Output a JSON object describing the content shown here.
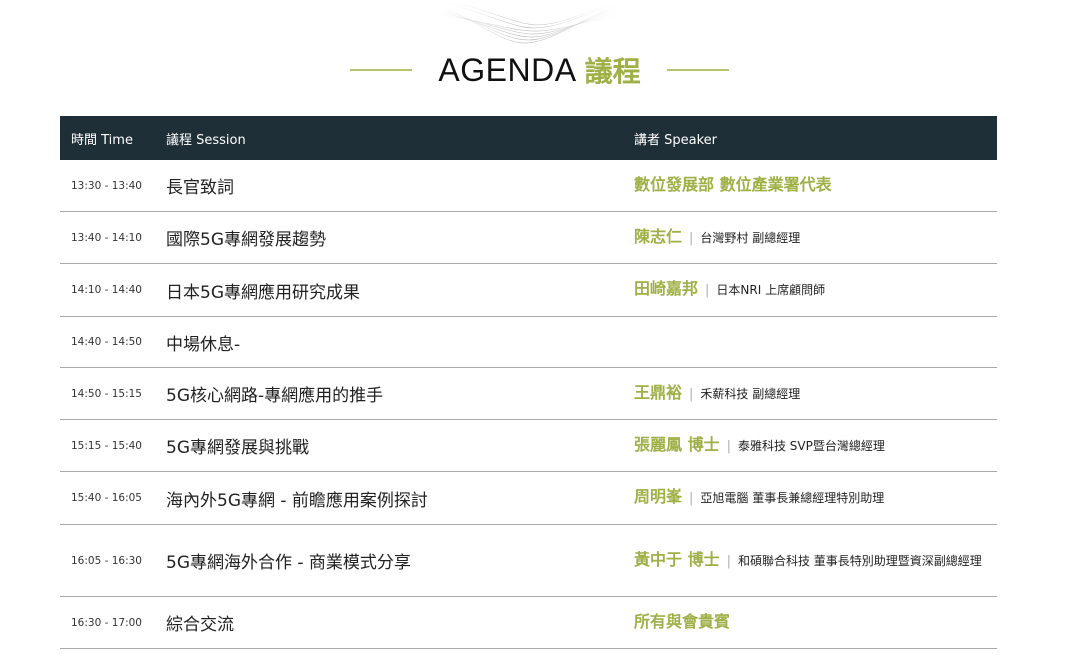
{
  "heading": {
    "title_en": "AGENDA",
    "title_zh": "議程"
  },
  "table": {
    "headers": {
      "time": "時間 Time",
      "session": "議程 Session",
      "speaker": "講者 Speaker"
    },
    "rows": [
      {
        "time": "13:30 - 13:40",
        "session": "長官致詞",
        "speaker_name": "數位發展部 數位產業署代表",
        "speaker_title": ""
      },
      {
        "time": "13:40 - 14:10",
        "session": "國際5G專網發展趨勢",
        "speaker_name": "陳志仁",
        "speaker_title": "台灣野村 副總經理"
      },
      {
        "time": "14:10 - 14:40",
        "session": "日本5G專網應用研究成果",
        "speaker_name": "田崎嘉邦",
        "speaker_title": "日本NRI 上席顧問師"
      },
      {
        "time": "14:40 - 14:50",
        "session": "中場休息-",
        "speaker_name": "",
        "speaker_title": ""
      },
      {
        "time": "14:50 - 15:15",
        "session": "5G核心網路-專網應用的推手",
        "speaker_name": "王鼎裕",
        "speaker_title": "禾薪科技 副總經理"
      },
      {
        "time": "15:15 - 15:40",
        "session": "5G專網發展與挑戰",
        "speaker_name": "張麗鳳 博士",
        "speaker_title": "泰雅科技 SVP暨台灣總經理"
      },
      {
        "time": "15:40 - 16:05",
        "session": "海內外5G專網 - 前瞻應用案例探討",
        "speaker_name": "周明峯",
        "speaker_title": "亞旭電腦 董事長兼總經理特別助理"
      },
      {
        "time": "16:05 - 16:30",
        "session": "5G專網海外合作 - 商業模式分享",
        "speaker_name": "黃中于 博士",
        "speaker_title": "和碩聯合科技 董事長特別助理暨資深副總經理"
      },
      {
        "time": "16:30 - 17:00",
        "session": "綜合交流",
        "speaker_name": "所有與會貴賓",
        "speaker_title": ""
      }
    ]
  },
  "colors": {
    "accent": "#9fb046",
    "header_bg": "#1e2f38",
    "divider": "#a9a9a9"
  }
}
